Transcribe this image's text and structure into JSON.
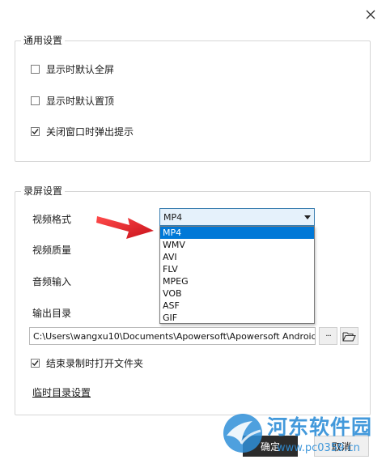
{
  "general": {
    "title": "通用设置",
    "options": [
      {
        "label": "显示时默认全屏",
        "checked": false
      },
      {
        "label": "显示时默认置顶",
        "checked": false
      },
      {
        "label": "关闭窗口时弹出提示",
        "checked": true
      }
    ]
  },
  "record": {
    "title": "录屏设置",
    "format_label": "视频格式",
    "quality_label": "视频质量",
    "audio_label": "音频输入",
    "output_label": "输出目录",
    "format_selected": "MP4",
    "format_options": [
      "MP4",
      "WMV",
      "AVI",
      "FLV",
      "MPEG",
      "VOB",
      "ASF",
      "GIF"
    ],
    "output_path": "C:\\Users\\wangxu10\\Documents\\Apowersoft\\Apowersoft Android",
    "more_label": "···",
    "open_folder_checkbox": {
      "label": "结束录制时打开文件夹",
      "checked": true
    },
    "temp_dir_link": "临时目录设置"
  },
  "footer": {
    "ok_label": "确定",
    "cancel_label": "取消"
  },
  "watermark": {
    "brand": "河东软件园",
    "url": "www.pc0359.cn"
  },
  "colors": {
    "accent": "#0078d7",
    "arrow": "#e8202a",
    "ok_button": "#2b2b2b"
  }
}
